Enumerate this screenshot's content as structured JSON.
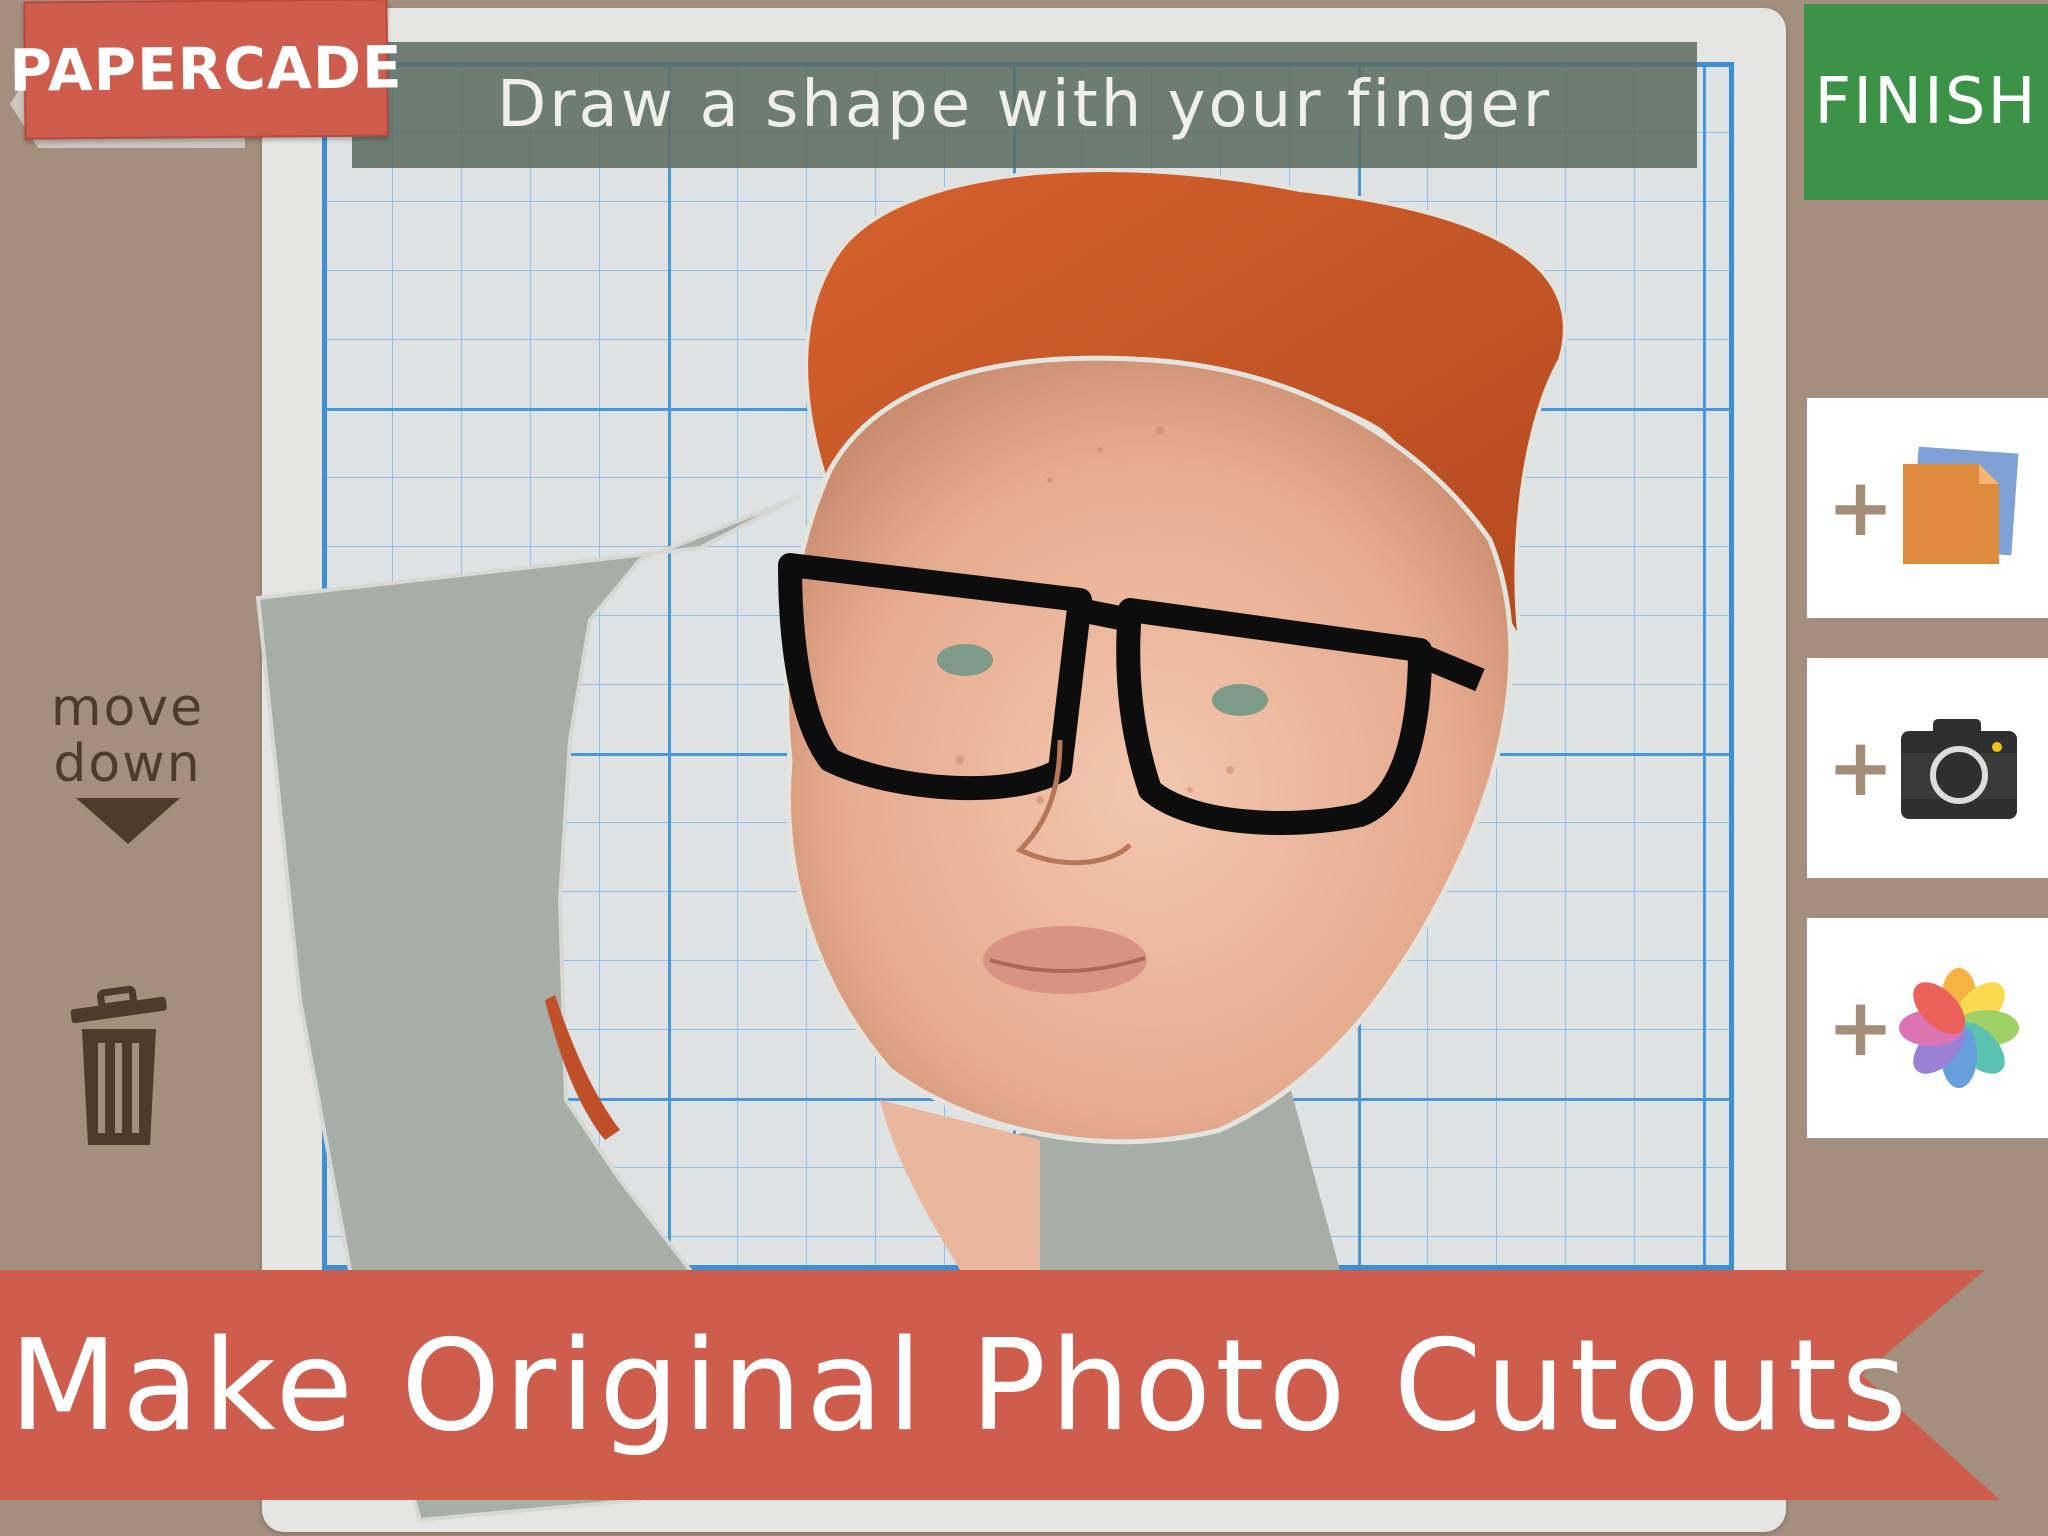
{
  "app": {
    "logo_text": "PAPERCADE"
  },
  "header": {
    "instruction": "Draw a shape with your finger"
  },
  "toolbar_right": {
    "finish_label": "FINISH",
    "add_buttons": [
      {
        "name": "add-paper",
        "icon": "paper-stack-icon"
      },
      {
        "name": "add-camera",
        "icon": "camera-icon"
      },
      {
        "name": "add-photos",
        "icon": "photos-flower-icon"
      }
    ],
    "plus_symbol": "+"
  },
  "toolbar_left": {
    "move_down_line1": "move",
    "move_down_line2": "down",
    "trash_icon": "trash-icon"
  },
  "banner": {
    "text": "Make Original Photo Cutouts"
  },
  "colors": {
    "background": "#a48e7d",
    "accent_red": "#cf5d4d",
    "finish_green": "#3c9347",
    "grid_blue": "#4a97d8"
  }
}
